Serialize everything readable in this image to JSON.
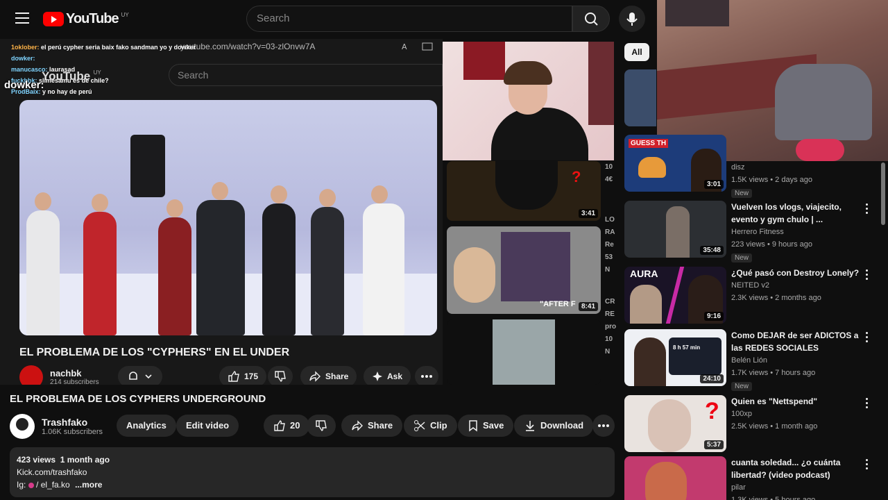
{
  "topbar": {
    "logo_text": "YouTube",
    "country": "UY",
    "search_placeholder": "Search"
  },
  "stream_overlay": {
    "url": "youtube.com/watch?v=03-zlOnvw7A",
    "inner_logo": "YouTube",
    "inner_country": "UY",
    "inner_search": "Search",
    "dowker_label": "dowker:",
    "chat": [
      {
        "user": "1oklober:",
        "text": "el perú cypher seria baix fako sandman yo y dowker"
      },
      {
        "user": "dowker:",
        "text": ""
      },
      {
        "user": "manucasco:",
        "text": "laurasad"
      },
      {
        "user": "fuckbbk:",
        "text": "slimesamu es de chile?"
      },
      {
        "user": "ProdBaix:",
        "text": "y no hay de perú"
      }
    ]
  },
  "embedded_video": {
    "title": "EL PROBLEMA DE LOS \"CYPHERS\" EN EL UNDER",
    "channel": "nachbk",
    "subs": "214 subscribers",
    "likes": "175",
    "share": "Share",
    "ask": "Ask"
  },
  "mid_recs": [
    {
      "duration": "3:41"
    },
    {
      "duration": "8:41",
      "caption": "\"AFTER F"
    },
    {
      "duration": ""
    }
  ],
  "mid_side_text": [
    "10",
    "4€",
    "LO",
    "RA",
    "Re",
    "53",
    "N",
    "CR",
    "RE",
    "pro",
    "10",
    "N"
  ],
  "chip_all": "All",
  "main": {
    "title": "EL PROBLEMA DE LOS CYPHERS UNDERGROUND",
    "channel": "Trashfako",
    "subscribers": "1.06K subscribers",
    "analytics": "Analytics",
    "edit_video": "Edit video",
    "likes": "20",
    "share": "Share",
    "clip": "Clip",
    "save": "Save",
    "download": "Download"
  },
  "description": {
    "views": "423 views",
    "date": "1 month ago",
    "line1": "Kick.com/trashfako",
    "ig_prefix": "Ig:",
    "ig_handle": "/ el_fa.ko",
    "more": "...more"
  },
  "recommendations": [
    {
      "title": "",
      "channel": "disz",
      "meta": "1.5K views • 2 days ago",
      "badge": "New",
      "duration": "3:01",
      "thumb_text": "GUESS TH"
    },
    {
      "title": "Vuelven los vlogs, viajecito, evento y gym chulo | ...",
      "channel": "Herrero Fitness",
      "meta": "223 views • 9 hours ago",
      "badge": "New",
      "duration": "35:48"
    },
    {
      "title": "¿Qué pasó con Destroy Lonely?",
      "channel": "NEITED v2",
      "meta": "2.3K views • 2 months ago",
      "badge": "",
      "duration": "9:16",
      "thumb_text": "AURA"
    },
    {
      "title": "Como DEJAR de ser ADICTOS a las REDES SOCIALES",
      "channel": "Belén Lión",
      "meta": "1.7K views • 7 hours ago",
      "badge": "New",
      "duration": "24:10",
      "thumb_text": "8 h 57 min"
    },
    {
      "title": "Quien es \"Nettspend\"",
      "channel": "100xp",
      "meta": "2.5K views • 1 month ago",
      "badge": "",
      "duration": "5:37"
    },
    {
      "title": "cuanta soledad... ¿o cuánta libertad? (video podcast)",
      "channel": "pilar",
      "meta": "1.3K views • 5 hours ago",
      "badge": "",
      "duration": ""
    }
  ],
  "colors": {
    "accent": "#ff0000",
    "bg": "#0f0f0f",
    "chip": "#272727"
  }
}
